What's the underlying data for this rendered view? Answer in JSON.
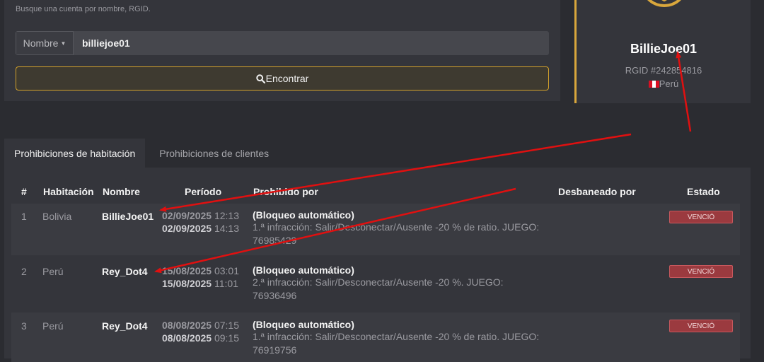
{
  "search": {
    "hint": "Busque una cuenta por nombre, RGID.",
    "field_type": "Nombre",
    "value": "billiejoe01",
    "find_label": "Encontrar"
  },
  "profile": {
    "name": "BillieJoe01",
    "rgid": "RGID #242854816",
    "country": "Perú"
  },
  "tabs": [
    "Prohibiciones de habitación",
    "Prohibiciones de clientes"
  ],
  "table": {
    "headers": [
      "#",
      "Habitación",
      "Nombre",
      "Período",
      "Prohibido por",
      "Desbaneado por",
      "Estado"
    ],
    "rows": [
      {
        "num": "1",
        "room": "Bolivia",
        "name": "BillieJoe01",
        "start_date": "02/09/2025",
        "start_time": "12:13",
        "end_date": "02/09/2025",
        "end_time": "14:13",
        "by": "(Bloqueo automático)",
        "reason": "1.ª infracción: Salir/Desconectar/Ausente -20 % de ratio. JUEGO: 76985429",
        "status": "VENCIÓ"
      },
      {
        "num": "2",
        "room": "Perú",
        "name": "Rey_Dot4",
        "start_date": "15/08/2025",
        "start_time": "03:01",
        "end_date": "15/08/2025",
        "end_time": "11:01",
        "by": "(Bloqueo automático)",
        "reason": "2.ª infracción: Salir/Desconectar/Ausente -20 %. JUEGO: 76936496",
        "status": "VENCIÓ"
      },
      {
        "num": "3",
        "room": "Perú",
        "name": "Rey_Dot4",
        "start_date": "08/08/2025",
        "start_time": "07:15",
        "end_date": "08/08/2025",
        "end_time": "09:15",
        "by": "(Bloqueo automático)",
        "reason": "1.ª infracción: Salir/Desconectar/Ausente -20 % de ratio. JUEGO: 76919756",
        "status": "VENCIÓ"
      }
    ]
  },
  "colors": {
    "accent": "#d9a73c",
    "annotation_red": "#e01010",
    "status_badge": "#9b3a3f"
  }
}
